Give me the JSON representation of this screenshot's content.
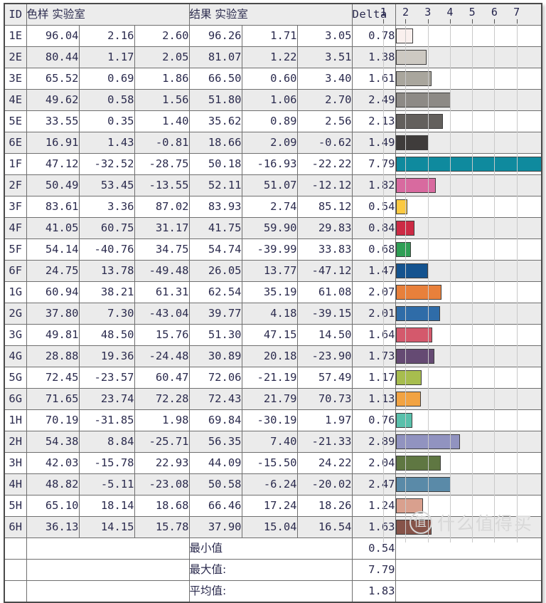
{
  "header": {
    "id": "ID",
    "sample_group": "色样 实验室",
    "result_group": "结果 实验室",
    "delta_e": "Delta E"
  },
  "axis": {
    "ticks": [
      "1",
      "2",
      "3",
      "4",
      "5",
      "6",
      "7"
    ],
    "min": 0,
    "max": 8.1
  },
  "summary": [
    {
      "label": "最小值",
      "value": "0.54"
    },
    {
      "label": "最大值:",
      "value": "7.79"
    },
    {
      "label": "平均值:",
      "value": "1.83"
    }
  ],
  "watermark": {
    "mark": "值",
    "text": "什么值得买"
  },
  "chart_data": {
    "type": "bar",
    "title": "Delta E",
    "xlabel": "Delta E",
    "ylabel": "",
    "xlim": [
      0,
      8.1
    ],
    "grid": true,
    "orientation": "horizontal",
    "categories": [
      "1E",
      "2E",
      "3E",
      "4E",
      "5E",
      "6E",
      "1F",
      "2F",
      "3F",
      "4F",
      "5F",
      "6F",
      "1G",
      "2G",
      "3G",
      "4G",
      "5G",
      "6G",
      "1H",
      "2H",
      "3H",
      "4H",
      "5H",
      "6H"
    ],
    "values": [
      0.78,
      1.38,
      1.61,
      2.49,
      2.13,
      1.49,
      7.79,
      1.82,
      0.54,
      0.84,
      0.68,
      1.47,
      2.07,
      2.01,
      1.64,
      1.73,
      1.17,
      1.13,
      0.76,
      2.89,
      2.04,
      2.47,
      1.24,
      1.63
    ],
    "bar_colors": [
      "#faf0ee",
      "#cdc9c2",
      "#a9a69d",
      "#8d8a86",
      "#63605d",
      "#3f3c3b",
      "#0f8a9e",
      "#d86a9f",
      "#fbc941",
      "#cc2a44",
      "#2e9e54",
      "#14538f",
      "#e8803b",
      "#2f6ca8",
      "#d4596c",
      "#654a73",
      "#a7bd4e",
      "#f2a342",
      "#59c0ab",
      "#9193c0",
      "#5f7742",
      "#5a8aa8",
      "#d9a08e",
      "#865349"
    ]
  },
  "rows": [
    {
      "id": "1E",
      "sample": [
        "96.04",
        "2.16",
        "2.60"
      ],
      "result": [
        "96.26",
        "1.71",
        "3.05"
      ],
      "de": "0.78",
      "color": "#faf0ee"
    },
    {
      "id": "2E",
      "sample": [
        "80.44",
        "1.17",
        "2.05"
      ],
      "result": [
        "81.07",
        "1.22",
        "3.51"
      ],
      "de": "1.38",
      "color": "#cdc9c2"
    },
    {
      "id": "3E",
      "sample": [
        "65.52",
        "0.69",
        "1.86"
      ],
      "result": [
        "66.50",
        "0.60",
        "3.40"
      ],
      "de": "1.61",
      "color": "#a9a69d"
    },
    {
      "id": "4E",
      "sample": [
        "49.62",
        "0.58",
        "1.56"
      ],
      "result": [
        "51.80",
        "1.06",
        "2.70"
      ],
      "de": "2.49",
      "color": "#8d8a86"
    },
    {
      "id": "5E",
      "sample": [
        "33.55",
        "0.35",
        "1.40"
      ],
      "result": [
        "35.62",
        "0.89",
        "2.56"
      ],
      "de": "2.13",
      "color": "#63605d"
    },
    {
      "id": "6E",
      "sample": [
        "16.91",
        "1.43",
        "-0.81"
      ],
      "result": [
        "18.66",
        "2.09",
        "-0.62"
      ],
      "de": "1.49",
      "color": "#3f3c3b"
    },
    {
      "id": "1F",
      "sample": [
        "47.12",
        "-32.52",
        "-28.75"
      ],
      "result": [
        "50.18",
        "-16.93",
        "-22.22"
      ],
      "de": "7.79",
      "color": "#0f8a9e"
    },
    {
      "id": "2F",
      "sample": [
        "50.49",
        "53.45",
        "-13.55"
      ],
      "result": [
        "52.11",
        "51.07",
        "-12.12"
      ],
      "de": "1.82",
      "color": "#d86a9f"
    },
    {
      "id": "3F",
      "sample": [
        "83.61",
        "3.36",
        "87.02"
      ],
      "result": [
        "83.93",
        "2.74",
        "85.12"
      ],
      "de": "0.54",
      "color": "#fbc941"
    },
    {
      "id": "4F",
      "sample": [
        "41.05",
        "60.75",
        "31.17"
      ],
      "result": [
        "41.75",
        "59.90",
        "29.83"
      ],
      "de": "0.84",
      "color": "#cc2a44"
    },
    {
      "id": "5F",
      "sample": [
        "54.14",
        "-40.76",
        "34.75"
      ],
      "result": [
        "54.74",
        "-39.99",
        "33.83"
      ],
      "de": "0.68",
      "color": "#2e9e54"
    },
    {
      "id": "6F",
      "sample": [
        "24.75",
        "13.78",
        "-49.48"
      ],
      "result": [
        "26.05",
        "13.77",
        "-47.12"
      ],
      "de": "1.47",
      "color": "#14538f"
    },
    {
      "id": "1G",
      "sample": [
        "60.94",
        "38.21",
        "61.31"
      ],
      "result": [
        "62.54",
        "35.19",
        "61.08"
      ],
      "de": "2.07",
      "color": "#e8803b"
    },
    {
      "id": "2G",
      "sample": [
        "37.80",
        "7.30",
        "-43.04"
      ],
      "result": [
        "39.77",
        "4.18",
        "-39.15"
      ],
      "de": "2.01",
      "color": "#2f6ca8"
    },
    {
      "id": "3G",
      "sample": [
        "49.81",
        "48.50",
        "15.76"
      ],
      "result": [
        "51.30",
        "47.15",
        "14.50"
      ],
      "de": "1.64",
      "color": "#d4596c"
    },
    {
      "id": "4G",
      "sample": [
        "28.88",
        "19.36",
        "-24.48"
      ],
      "result": [
        "30.89",
        "20.18",
        "-23.90"
      ],
      "de": "1.73",
      "color": "#654a73"
    },
    {
      "id": "5G",
      "sample": [
        "72.45",
        "-23.57",
        "60.47"
      ],
      "result": [
        "72.06",
        "-21.19",
        "57.49"
      ],
      "de": "1.17",
      "color": "#a7bd4e"
    },
    {
      "id": "6G",
      "sample": [
        "71.65",
        "23.74",
        "72.28"
      ],
      "result": [
        "72.43",
        "21.79",
        "70.73"
      ],
      "de": "1.13",
      "color": "#f2a342"
    },
    {
      "id": "1H",
      "sample": [
        "70.19",
        "-31.85",
        "1.98"
      ],
      "result": [
        "69.84",
        "-30.19",
        "1.97"
      ],
      "de": "0.76",
      "color": "#59c0ab"
    },
    {
      "id": "2H",
      "sample": [
        "54.38",
        "8.84",
        "-25.71"
      ],
      "result": [
        "56.35",
        "7.40",
        "-21.33"
      ],
      "de": "2.89",
      "color": "#9193c0"
    },
    {
      "id": "3H",
      "sample": [
        "42.03",
        "-15.78",
        "22.93"
      ],
      "result": [
        "44.09",
        "-15.50",
        "24.22"
      ],
      "de": "2.04",
      "color": "#5f7742"
    },
    {
      "id": "4H",
      "sample": [
        "48.82",
        "-5.11",
        "-23.08"
      ],
      "result": [
        "50.58",
        "-6.24",
        "-20.02"
      ],
      "de": "2.47",
      "color": "#5a8aa8"
    },
    {
      "id": "5H",
      "sample": [
        "65.10",
        "18.14",
        "18.68"
      ],
      "result": [
        "66.46",
        "17.24",
        "18.26"
      ],
      "de": "1.24",
      "color": "#d9a08e"
    },
    {
      "id": "6H",
      "sample": [
        "36.13",
        "14.15",
        "15.78"
      ],
      "result": [
        "37.90",
        "15.04",
        "16.54"
      ],
      "de": "1.63",
      "color": "#865349"
    }
  ]
}
